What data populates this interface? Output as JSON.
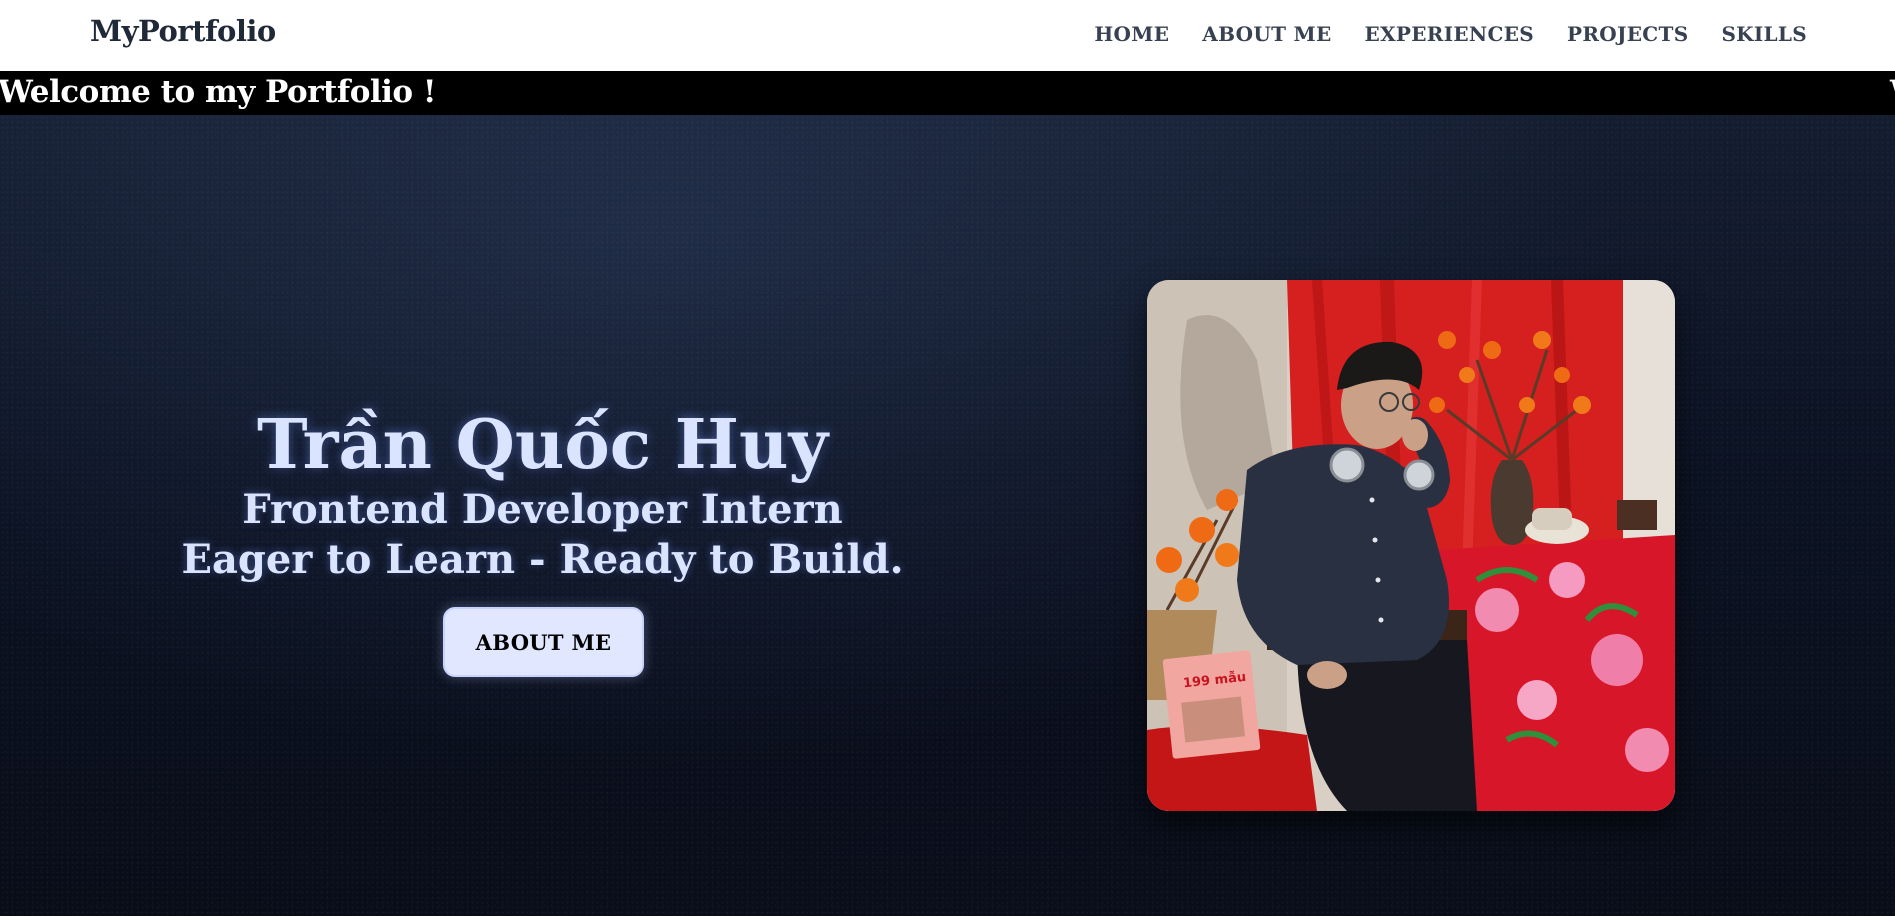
{
  "header": {
    "brand": "MyPortfolio",
    "nav": [
      {
        "label": "HOME"
      },
      {
        "label": "ABOUT ME"
      },
      {
        "label": "EXPERIENCES"
      },
      {
        "label": "PROJECTS"
      },
      {
        "label": "SKILLS"
      }
    ]
  },
  "marquee": {
    "text": "Welcome to my Portfolio !",
    "next_fragment": "W"
  },
  "hero": {
    "name": "Trần Quốc Huy",
    "role": "Frontend Developer Intern",
    "tagline": "Eager to Learn - Ready to Build.",
    "button_label": "ABOUT ME",
    "book_label": "199 mẫu"
  },
  "colors": {
    "header_bg": "#ffffff",
    "nav_text": "#374151",
    "marquee_bg": "#000000",
    "hero_bg": "#0b1120",
    "hero_text": "#dbe4ff",
    "button_bg": "#e0e7ff"
  }
}
